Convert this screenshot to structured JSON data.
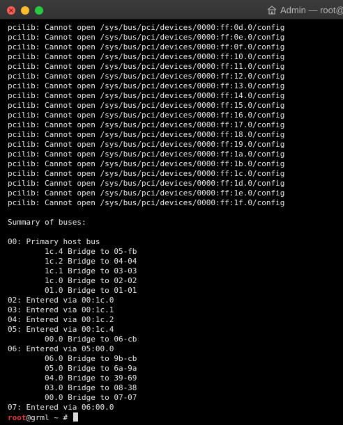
{
  "window": {
    "title": "Admin — root@",
    "controls": {
      "close": "close-icon",
      "minimize": "minimize-icon",
      "maximize": "maximize-icon"
    },
    "title_icon": "home-folder-icon"
  },
  "colors": {
    "background": "#000000",
    "text": "#e6e6e6",
    "prompt_user": "#e13a3a",
    "close": "#fe5f57",
    "minimize": "#febc2e",
    "maximize": "#28c840"
  },
  "terminal": {
    "lines": [
      "pcilib: Cannot open /sys/bus/pci/devices/0000:ff:0d.0/config",
      "pcilib: Cannot open /sys/bus/pci/devices/0000:ff:0e.0/config",
      "pcilib: Cannot open /sys/bus/pci/devices/0000:ff:0f.0/config",
      "pcilib: Cannot open /sys/bus/pci/devices/0000:ff:10.0/config",
      "pcilib: Cannot open /sys/bus/pci/devices/0000:ff:11.0/config",
      "pcilib: Cannot open /sys/bus/pci/devices/0000:ff:12.0/config",
      "pcilib: Cannot open /sys/bus/pci/devices/0000:ff:13.0/config",
      "pcilib: Cannot open /sys/bus/pci/devices/0000:ff:14.0/config",
      "pcilib: Cannot open /sys/bus/pci/devices/0000:ff:15.0/config",
      "pcilib: Cannot open /sys/bus/pci/devices/0000:ff:16.0/config",
      "pcilib: Cannot open /sys/bus/pci/devices/0000:ff:17.0/config",
      "pcilib: Cannot open /sys/bus/pci/devices/0000:ff:18.0/config",
      "pcilib: Cannot open /sys/bus/pci/devices/0000:ff:19.0/config",
      "pcilib: Cannot open /sys/bus/pci/devices/0000:ff:1a.0/config",
      "pcilib: Cannot open /sys/bus/pci/devices/0000:ff:1b.0/config",
      "pcilib: Cannot open /sys/bus/pci/devices/0000:ff:1c.0/config",
      "pcilib: Cannot open /sys/bus/pci/devices/0000:ff:1d.0/config",
      "pcilib: Cannot open /sys/bus/pci/devices/0000:ff:1e.0/config",
      "pcilib: Cannot open /sys/bus/pci/devices/0000:ff:1f.0/config",
      "",
      "Summary of buses:",
      "",
      "00: Primary host bus",
      "        1c.4 Bridge to 05-fb",
      "        1c.2 Bridge to 04-04",
      "        1c.1 Bridge to 03-03",
      "        1c.0 Bridge to 02-02",
      "        01.0 Bridge to 01-01",
      "02: Entered via 00:1c.0",
      "03: Entered via 00:1c.1",
      "04: Entered via 00:1c.2",
      "05: Entered via 00:1c.4",
      "        00.0 Bridge to 06-cb",
      "06: Entered via 05:00.0",
      "        06.0 Bridge to 9b-cb",
      "        05.0 Bridge to 6a-9a",
      "        04.0 Bridge to 39-69",
      "        03.0 Bridge to 08-38",
      "        00.0 Bridge to 07-07",
      "07: Entered via 06:00.0"
    ],
    "prompt": {
      "user": "root",
      "rest": "@grml ~ # "
    }
  }
}
